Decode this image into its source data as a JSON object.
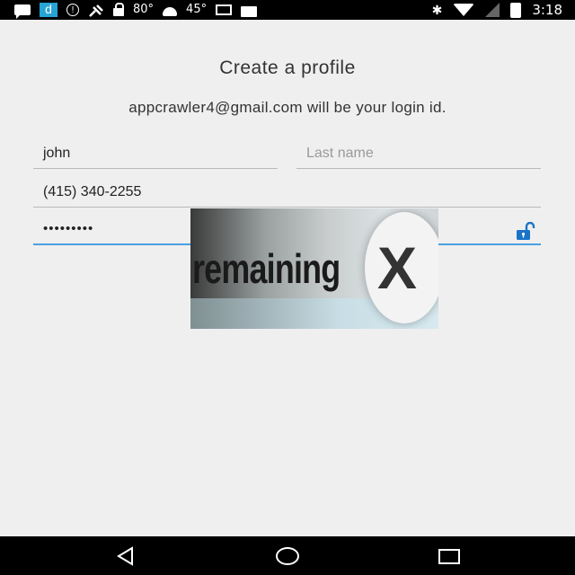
{
  "status_bar": {
    "icons_left": [
      "chat-icon",
      "d-app-icon",
      "info-icon",
      "satellite-icon",
      "lock-icon",
      "android-icon",
      "photo-icon",
      "briefcase-icon"
    ],
    "temp1": "80°",
    "temp2": "45°",
    "icons_right": [
      "bluetooth-icon",
      "wifi-icon",
      "signal-icon",
      "battery-icon"
    ],
    "time": "3:18"
  },
  "form": {
    "title": "Create a profile",
    "subtitle": "appcrawler4@gmail.com will be your login id.",
    "first_name": {
      "value": "john"
    },
    "last_name": {
      "value": "",
      "placeholder": "Last name"
    },
    "phone": {
      "value": "(415) 340-2255"
    },
    "password": {
      "value": "•••••••••"
    }
  },
  "ad_overlay": {
    "text": "remaining",
    "close_glyph": "X"
  },
  "colors": {
    "background": "#efefef",
    "accent": "#4aa0e0",
    "unlock_icon": "#1a73c8"
  }
}
